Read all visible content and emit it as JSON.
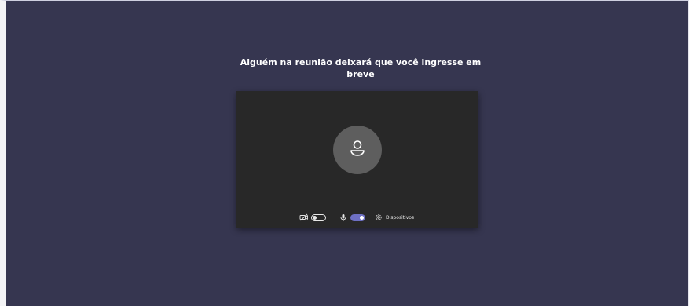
{
  "prejoin": {
    "heading": "Alguém na reunião deixará que você ingresse em breve",
    "camera": {
      "icon": "camera-off-icon",
      "enabled": false
    },
    "microphone": {
      "icon": "microphone-icon",
      "enabled": true
    },
    "devices": {
      "icon": "gear-icon",
      "label": "Dispositivos"
    }
  },
  "colors": {
    "background": "#363650",
    "preview": "#282828",
    "avatar": "#5e5e5e",
    "accent": "#6e70c4"
  }
}
